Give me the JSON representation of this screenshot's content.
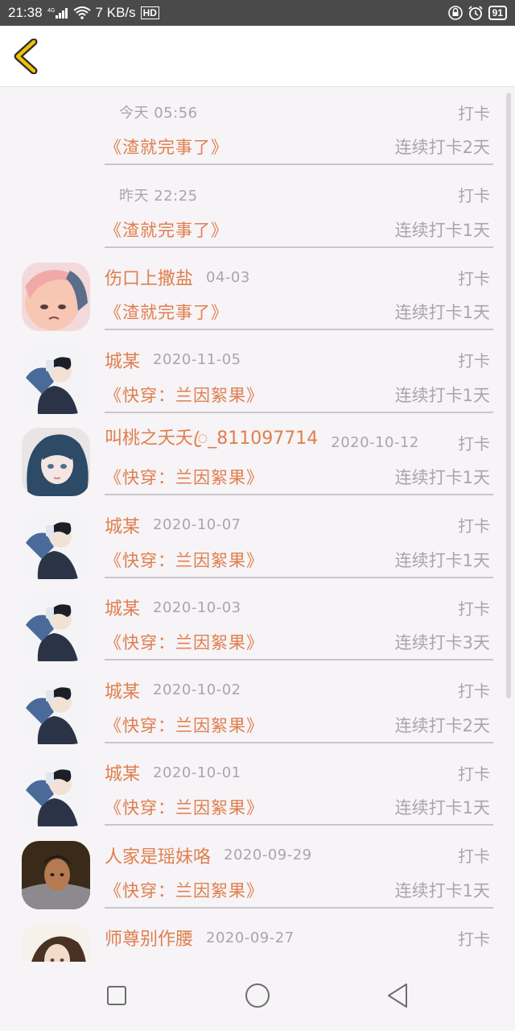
{
  "status": {
    "time": "21:38",
    "signal_badge": "4G",
    "speed": "7 KB/s",
    "hd": "HD",
    "battery": "91",
    "icons": [
      "signal-icon",
      "wifi-icon",
      "lock-icon",
      "alarm-icon",
      "battery-icon"
    ]
  },
  "header": {
    "back_icon": "chevron-left-icon",
    "accent": "#f2c200"
  },
  "colors": {
    "accent": "#e07e4e",
    "muted": "#a8a6a8",
    "divider": "#c8c6c8"
  },
  "rows": [
    {
      "user": "",
      "date": "今天 05:56",
      "action": "打卡",
      "book": "《渣就完事了》",
      "streak": "连续打卡2天",
      "avatar": "none"
    },
    {
      "user": "",
      "date": "昨天 22:25",
      "action": "打卡",
      "book": "《渣就完事了》",
      "streak": "连续打卡1天",
      "avatar": "none"
    },
    {
      "user": "伤口上撒盐",
      "date": "04-03",
      "action": "打卡",
      "book": "《渣就完事了》",
      "streak": "连续打卡1天",
      "avatar": "pink"
    },
    {
      "user": "城某",
      "date": "2020-11-05",
      "action": "打卡",
      "book": "《快穿：兰因絮果》",
      "streak": "连续打卡1天",
      "avatar": "boy"
    },
    {
      "user": "叫桃之夭夭ꦿ_811097714",
      "date": "2020-10-12",
      "action": "打卡",
      "book": "《快穿：兰因絮果》",
      "streak": "连续打卡1天",
      "avatar": "girl"
    },
    {
      "user": "城某",
      "date": "2020-10-07",
      "action": "打卡",
      "book": "《快穿：兰因絮果》",
      "streak": "连续打卡1天",
      "avatar": "boy"
    },
    {
      "user": "城某",
      "date": "2020-10-03",
      "action": "打卡",
      "book": "《快穿：兰因絮果》",
      "streak": "连续打卡3天",
      "avatar": "boy"
    },
    {
      "user": "城某",
      "date": "2020-10-02",
      "action": "打卡",
      "book": "《快穿：兰因絮果》",
      "streak": "连续打卡2天",
      "avatar": "boy"
    },
    {
      "user": "城某",
      "date": "2020-10-01",
      "action": "打卡",
      "book": "《快穿：兰因絮果》",
      "streak": "连续打卡1天",
      "avatar": "boy"
    },
    {
      "user": "人家是瑶妹咯",
      "date": "2020-09-29",
      "action": "打卡",
      "book": "《快穿：兰因絮果》",
      "streak": "连续打卡1天",
      "avatar": "lady"
    },
    {
      "user": "师尊别作腰",
      "date": "2020-09-27",
      "action": "打卡",
      "book": "",
      "streak": "",
      "avatar": "anime"
    }
  ],
  "navbar": {
    "icons": [
      "recents-square-icon",
      "home-circle-icon",
      "back-triangle-icon"
    ]
  }
}
